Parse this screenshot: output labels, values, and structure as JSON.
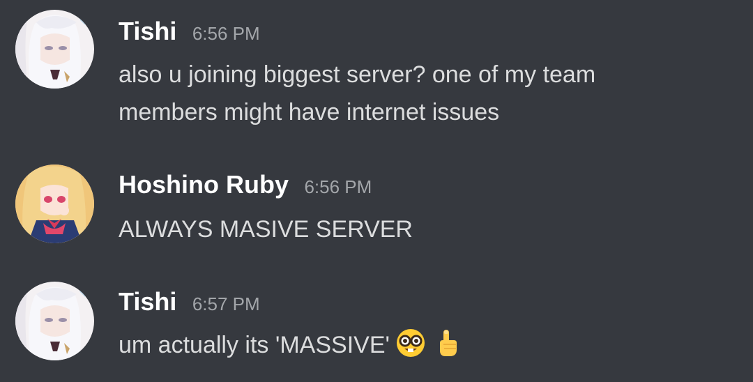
{
  "messages": [
    {
      "author": "Tishi",
      "time": "6:56 PM",
      "lines": [
        "also u joining biggest server? one of my team",
        "members might have internet issues"
      ]
    },
    {
      "author": "Hoshino Ruby",
      "time": "6:56 PM",
      "lines": [
        "ALWAYS MASIVE SERVER"
      ]
    },
    {
      "author": "Tishi",
      "time": "6:57 PM",
      "text": "um actually its 'MASSIVE'",
      "emojis": [
        "nerd-face-emoji",
        "pointing-up-emoji"
      ]
    }
  ],
  "colors": {
    "background": "#36393f",
    "username": "#ffffff",
    "timestamp": "#a3a6aa",
    "message_text": "#dcddde"
  }
}
